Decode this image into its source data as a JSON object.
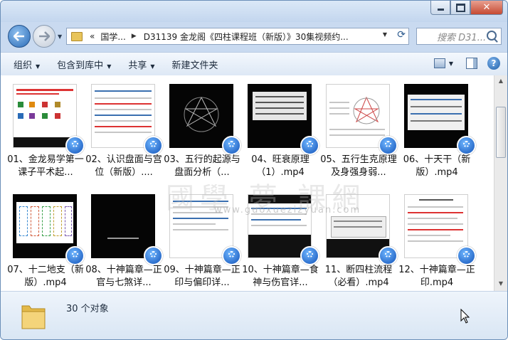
{
  "address": {
    "crumbs_prefix": "«",
    "crumb1": "国学...",
    "crumb2": "D31139 金龙阁《四柱课程班（新版）》30集视频约..."
  },
  "search": {
    "placeholder": "搜索 D31..."
  },
  "toolbar": {
    "organize": "组织",
    "include_library": "包含到库中",
    "share": "共享",
    "new_folder": "新建文件夹"
  },
  "files": [
    {
      "name": "01、金龙易学第一课子平术起..."
    },
    {
      "name": "02、认识盘面与宫位（新版）...."
    },
    {
      "name": "03、五行的起源与盘面分析（..."
    },
    {
      "name": "04、旺衰原理（1）.mp4"
    },
    {
      "name": "05、五行生克原理及身强身弱..."
    },
    {
      "name": "06、十天干（新版）.mp4"
    },
    {
      "name": "07、十二地支（新版）.mp4"
    },
    {
      "name": "08、十神篇章—正官与七煞详..."
    },
    {
      "name": "09、十神篇章—正印与偏印详..."
    },
    {
      "name": "10、十神篇章—食神与伤官详..."
    },
    {
      "name": "11、断四柱流程（必看）.mp4"
    },
    {
      "name": "12、十神篇章—正印.mp4"
    }
  ],
  "status": {
    "item_count": "30 个对象"
  },
  "watermark": {
    "main": "國學 夢 課網",
    "url": "www.guoxuezizyuan.com"
  },
  "colors": {
    "accent": "#2a6bb7",
    "titlebar": "#c9daf0",
    "close": "#c64a32"
  }
}
